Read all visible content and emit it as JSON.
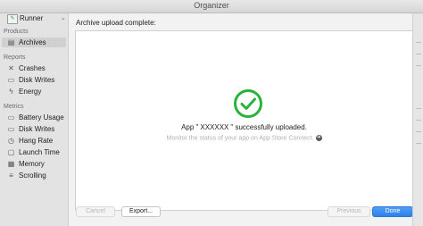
{
  "window": {
    "title": "Organizer"
  },
  "sidebar": {
    "project": "Runner",
    "sections": [
      {
        "title": "Products",
        "items": [
          {
            "label": "Archives",
            "icon": "archive-icon",
            "selected": true
          }
        ]
      },
      {
        "title": "Reports",
        "items": [
          {
            "label": "Crashes",
            "icon": "crash-icon"
          },
          {
            "label": "Disk Writes",
            "icon": "disk-writes-icon"
          },
          {
            "label": "Energy",
            "icon": "energy-icon"
          }
        ]
      },
      {
        "title": "Metrics",
        "items": [
          {
            "label": "Battery Usage",
            "icon": "battery-icon"
          },
          {
            "label": "Disk Writes",
            "icon": "disk-writes-icon"
          },
          {
            "label": "Hang Rate",
            "icon": "hang-rate-icon"
          },
          {
            "label": "Launch Time",
            "icon": "launch-time-icon"
          },
          {
            "label": "Memory",
            "icon": "memory-icon"
          },
          {
            "label": "Scrolling",
            "icon": "scrolling-icon"
          }
        ]
      }
    ]
  },
  "main": {
    "heading": "Archive upload complete:",
    "message_prefix": "App \"",
    "app_name": "XXXXXX",
    "message_suffix": "\" successfully uploaded.",
    "sub_message": "Monitor the status of your app on App Store Connect.",
    "success_color": "#28b33c"
  },
  "buttons": {
    "cancel": "Cancel",
    "export": "Export...",
    "previous": "Previous",
    "done": "Done"
  }
}
